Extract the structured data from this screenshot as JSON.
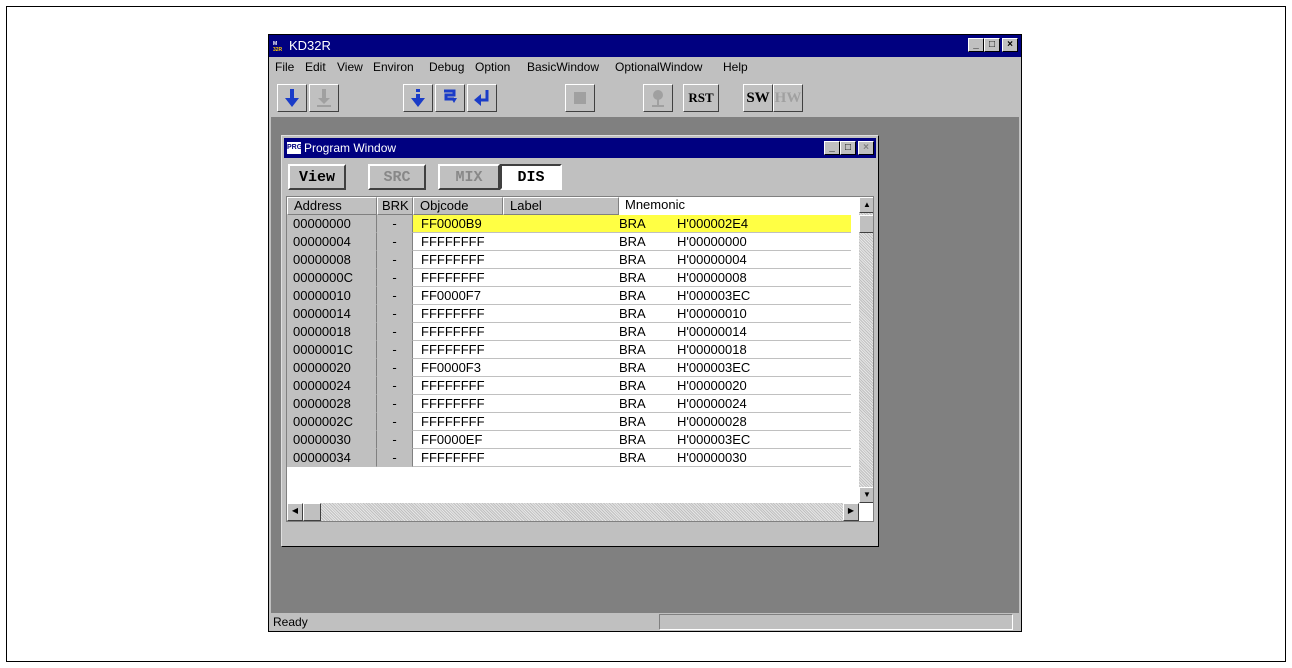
{
  "app": {
    "title": "KD32R",
    "icon_text": "KD32R",
    "status": "Ready"
  },
  "menu": [
    {
      "label": "File"
    },
    {
      "label": "Edit"
    },
    {
      "label": "View"
    },
    {
      "label": "Environ"
    },
    {
      "label": "Debug"
    },
    {
      "label": "Option"
    },
    {
      "label": "BasicWindow"
    },
    {
      "label": "OptionalWindow"
    },
    {
      "label": "Help"
    }
  ],
  "toolbar": {
    "rst_label": "RST",
    "sw_label": "SW",
    "hw_label": "HW",
    "accent_color": "#1a3cc8"
  },
  "program_window": {
    "title": "Program Window",
    "buttons": {
      "view": "View",
      "src": "SRC",
      "mix": "MIX",
      "dis": "DIS"
    },
    "columns": [
      "Address",
      "BRK",
      "Objcode",
      "Label",
      "Mnemonic"
    ],
    "highlight_color": "#ffff44",
    "rows": [
      {
        "address": "00000000",
        "brk": "-",
        "objcode": "FF0000B9",
        "label": "",
        "mnemonic": "BRA",
        "operand": "H'000002E4"
      },
      {
        "address": "00000004",
        "brk": "-",
        "objcode": "FFFFFFFF",
        "label": "",
        "mnemonic": "BRA",
        "operand": "H'00000000"
      },
      {
        "address": "00000008",
        "brk": "-",
        "objcode": "FFFFFFFF",
        "label": "",
        "mnemonic": "BRA",
        "operand": "H'00000004"
      },
      {
        "address": "0000000C",
        "brk": "-",
        "objcode": "FFFFFFFF",
        "label": "",
        "mnemonic": "BRA",
        "operand": "H'00000008"
      },
      {
        "address": "00000010",
        "brk": "-",
        "objcode": "FF0000F7",
        "label": "",
        "mnemonic": "BRA",
        "operand": "H'000003EC"
      },
      {
        "address": "00000014",
        "brk": "-",
        "objcode": "FFFFFFFF",
        "label": "",
        "mnemonic": "BRA",
        "operand": "H'00000010"
      },
      {
        "address": "00000018",
        "brk": "-",
        "objcode": "FFFFFFFF",
        "label": "",
        "mnemonic": "BRA",
        "operand": "H'00000014"
      },
      {
        "address": "0000001C",
        "brk": "-",
        "objcode": "FFFFFFFF",
        "label": "",
        "mnemonic": "BRA",
        "operand": "H'00000018"
      },
      {
        "address": "00000020",
        "brk": "-",
        "objcode": "FF0000F3",
        "label": "",
        "mnemonic": "BRA",
        "operand": "H'000003EC"
      },
      {
        "address": "00000024",
        "brk": "-",
        "objcode": "FFFFFFFF",
        "label": "",
        "mnemonic": "BRA",
        "operand": "H'00000020"
      },
      {
        "address": "00000028",
        "brk": "-",
        "objcode": "FFFFFFFF",
        "label": "",
        "mnemonic": "BRA",
        "operand": "H'00000024"
      },
      {
        "address": "0000002C",
        "brk": "-",
        "objcode": "FFFFFFFF",
        "label": "",
        "mnemonic": "BRA",
        "operand": "H'00000028"
      },
      {
        "address": "00000030",
        "brk": "-",
        "objcode": "FF0000EF",
        "label": "",
        "mnemonic": "BRA",
        "operand": "H'000003EC"
      },
      {
        "address": "00000034",
        "brk": "-",
        "objcode": "FFFFFFFF",
        "label": "",
        "mnemonic": "BRA",
        "operand": "H'00000030"
      }
    ]
  }
}
